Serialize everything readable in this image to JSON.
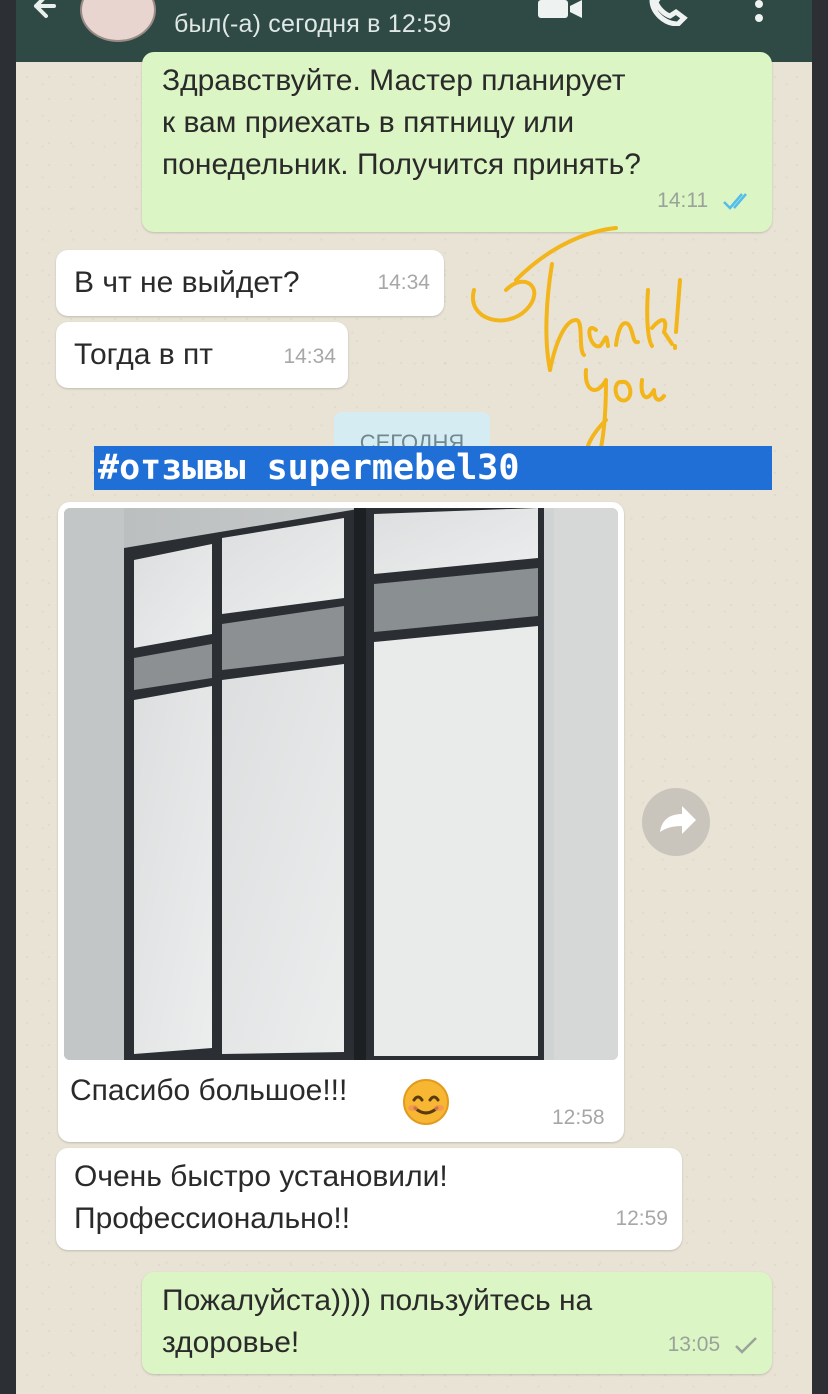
{
  "header": {
    "status": "был(-а) сегодня в 12:59",
    "color": "#2f4a45"
  },
  "messages": {
    "m1": {
      "text_lines": [
        "Здравствуйте. Мастер планирует",
        "к вам приехать в пятницу или",
        "понедельник. Получится принять?"
      ],
      "time": "14:11",
      "status": "read"
    },
    "m2": {
      "text": "В чт не выйдет?",
      "time": "14:34"
    },
    "m3": {
      "text": "Тогда в пт",
      "time": "14:34"
    },
    "m4": {
      "text": "Спасибо большое!!!",
      "time": "12:58",
      "emoji": "smiling-face"
    },
    "m5": {
      "text_lines": [
        "Очень быстро установили!",
        "Профессионально!!"
      ],
      "time": "12:59"
    },
    "m6": {
      "text_lines": [
        "Пожалуйста)))) пользуйтесь на",
        "здоровье!"
      ],
      "time": "13:05",
      "status": "sent"
    }
  },
  "date_divider": "СЕГОДНЯ",
  "overlay": {
    "hashtag": "#отзывы supermebel30",
    "hashtag_bg": "#1f6fd6",
    "sticker": "Thank you!",
    "sticker_color": "#f2b51c"
  },
  "colors": {
    "outgoing_bubble": "#dcf5c4",
    "incoming_bubble": "#ffffff",
    "chat_background": "#e9e3d6",
    "read_ticks": "#53bdeb"
  }
}
